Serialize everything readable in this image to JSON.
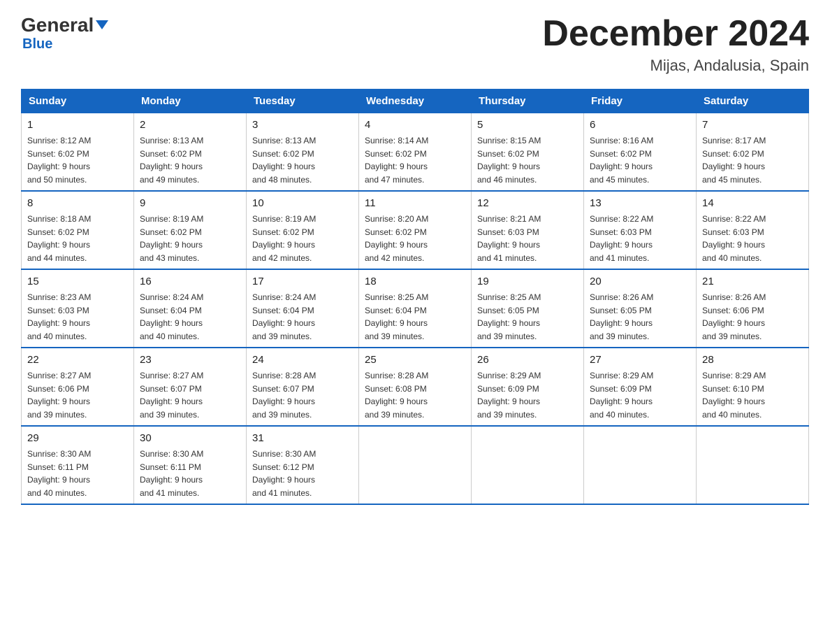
{
  "logo": {
    "general": "General",
    "triangle": "▶",
    "blue": "Blue"
  },
  "header": {
    "month": "December 2024",
    "location": "Mijas, Andalusia, Spain"
  },
  "days_of_week": [
    "Sunday",
    "Monday",
    "Tuesday",
    "Wednesday",
    "Thursday",
    "Friday",
    "Saturday"
  ],
  "weeks": [
    [
      {
        "day": "1",
        "sunrise": "8:12 AM",
        "sunset": "6:02 PM",
        "daylight": "9 hours and 50 minutes."
      },
      {
        "day": "2",
        "sunrise": "8:13 AM",
        "sunset": "6:02 PM",
        "daylight": "9 hours and 49 minutes."
      },
      {
        "day": "3",
        "sunrise": "8:13 AM",
        "sunset": "6:02 PM",
        "daylight": "9 hours and 48 minutes."
      },
      {
        "day": "4",
        "sunrise": "8:14 AM",
        "sunset": "6:02 PM",
        "daylight": "9 hours and 47 minutes."
      },
      {
        "day": "5",
        "sunrise": "8:15 AM",
        "sunset": "6:02 PM",
        "daylight": "9 hours and 46 minutes."
      },
      {
        "day": "6",
        "sunrise": "8:16 AM",
        "sunset": "6:02 PM",
        "daylight": "9 hours and 45 minutes."
      },
      {
        "day": "7",
        "sunrise": "8:17 AM",
        "sunset": "6:02 PM",
        "daylight": "9 hours and 45 minutes."
      }
    ],
    [
      {
        "day": "8",
        "sunrise": "8:18 AM",
        "sunset": "6:02 PM",
        "daylight": "9 hours and 44 minutes."
      },
      {
        "day": "9",
        "sunrise": "8:19 AM",
        "sunset": "6:02 PM",
        "daylight": "9 hours and 43 minutes."
      },
      {
        "day": "10",
        "sunrise": "8:19 AM",
        "sunset": "6:02 PM",
        "daylight": "9 hours and 42 minutes."
      },
      {
        "day": "11",
        "sunrise": "8:20 AM",
        "sunset": "6:02 PM",
        "daylight": "9 hours and 42 minutes."
      },
      {
        "day": "12",
        "sunrise": "8:21 AM",
        "sunset": "6:03 PM",
        "daylight": "9 hours and 41 minutes."
      },
      {
        "day": "13",
        "sunrise": "8:22 AM",
        "sunset": "6:03 PM",
        "daylight": "9 hours and 41 minutes."
      },
      {
        "day": "14",
        "sunrise": "8:22 AM",
        "sunset": "6:03 PM",
        "daylight": "9 hours and 40 minutes."
      }
    ],
    [
      {
        "day": "15",
        "sunrise": "8:23 AM",
        "sunset": "6:03 PM",
        "daylight": "9 hours and 40 minutes."
      },
      {
        "day": "16",
        "sunrise": "8:24 AM",
        "sunset": "6:04 PM",
        "daylight": "9 hours and 40 minutes."
      },
      {
        "day": "17",
        "sunrise": "8:24 AM",
        "sunset": "6:04 PM",
        "daylight": "9 hours and 39 minutes."
      },
      {
        "day": "18",
        "sunrise": "8:25 AM",
        "sunset": "6:04 PM",
        "daylight": "9 hours and 39 minutes."
      },
      {
        "day": "19",
        "sunrise": "8:25 AM",
        "sunset": "6:05 PM",
        "daylight": "9 hours and 39 minutes."
      },
      {
        "day": "20",
        "sunrise": "8:26 AM",
        "sunset": "6:05 PM",
        "daylight": "9 hours and 39 minutes."
      },
      {
        "day": "21",
        "sunrise": "8:26 AM",
        "sunset": "6:06 PM",
        "daylight": "9 hours and 39 minutes."
      }
    ],
    [
      {
        "day": "22",
        "sunrise": "8:27 AM",
        "sunset": "6:06 PM",
        "daylight": "9 hours and 39 minutes."
      },
      {
        "day": "23",
        "sunrise": "8:27 AM",
        "sunset": "6:07 PM",
        "daylight": "9 hours and 39 minutes."
      },
      {
        "day": "24",
        "sunrise": "8:28 AM",
        "sunset": "6:07 PM",
        "daylight": "9 hours and 39 minutes."
      },
      {
        "day": "25",
        "sunrise": "8:28 AM",
        "sunset": "6:08 PM",
        "daylight": "9 hours and 39 minutes."
      },
      {
        "day": "26",
        "sunrise": "8:29 AM",
        "sunset": "6:09 PM",
        "daylight": "9 hours and 39 minutes."
      },
      {
        "day": "27",
        "sunrise": "8:29 AM",
        "sunset": "6:09 PM",
        "daylight": "9 hours and 40 minutes."
      },
      {
        "day": "28",
        "sunrise": "8:29 AM",
        "sunset": "6:10 PM",
        "daylight": "9 hours and 40 minutes."
      }
    ],
    [
      {
        "day": "29",
        "sunrise": "8:30 AM",
        "sunset": "6:11 PM",
        "daylight": "9 hours and 40 minutes."
      },
      {
        "day": "30",
        "sunrise": "8:30 AM",
        "sunset": "6:11 PM",
        "daylight": "9 hours and 41 minutes."
      },
      {
        "day": "31",
        "sunrise": "8:30 AM",
        "sunset": "6:12 PM",
        "daylight": "9 hours and 41 minutes."
      },
      null,
      null,
      null,
      null
    ]
  ]
}
